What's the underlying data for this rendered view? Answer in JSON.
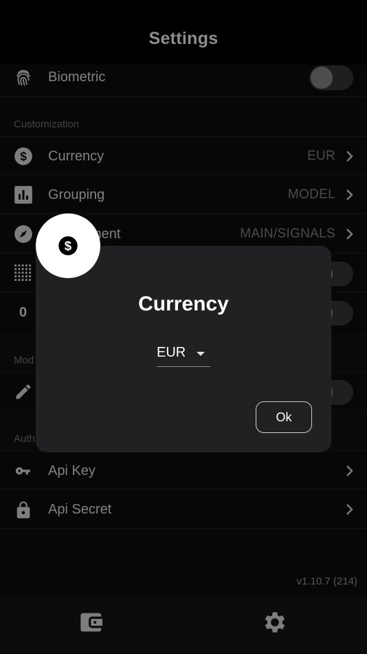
{
  "header": {
    "title": "Settings"
  },
  "rows": {
    "biometric": {
      "label": "Biometric",
      "icon": "fingerprint-icon"
    },
    "currency": {
      "label": "Currency",
      "value": "EUR",
      "icon": "dollar-circle-icon"
    },
    "grouping": {
      "label": "Grouping",
      "value": "MODEL",
      "icon": "bar-chart-icon"
    },
    "environment": {
      "label_visible": "ment",
      "value": "MAIN/SIGNALS",
      "icon": "compass-icon"
    },
    "grid": {
      "icon": "dots-grid-icon"
    },
    "zero": {
      "label": "0"
    },
    "edit": {
      "icon": "pencil-icon"
    },
    "api_key": {
      "label": "Api Key",
      "icon": "key-icon"
    },
    "api_secret": {
      "label": "Api Secret",
      "icon": "lock-icon"
    }
  },
  "sections": {
    "customization": "Customization",
    "mode_partial": "Mod",
    "auth_partial": "Auth"
  },
  "version": "v1.10.7 (214)",
  "dialog": {
    "title": "Currency",
    "selected": "EUR",
    "ok_label": "Ok"
  },
  "colors": {
    "background": "#0d0d0d",
    "dialog": "#212123",
    "accent": "#ffffff"
  }
}
